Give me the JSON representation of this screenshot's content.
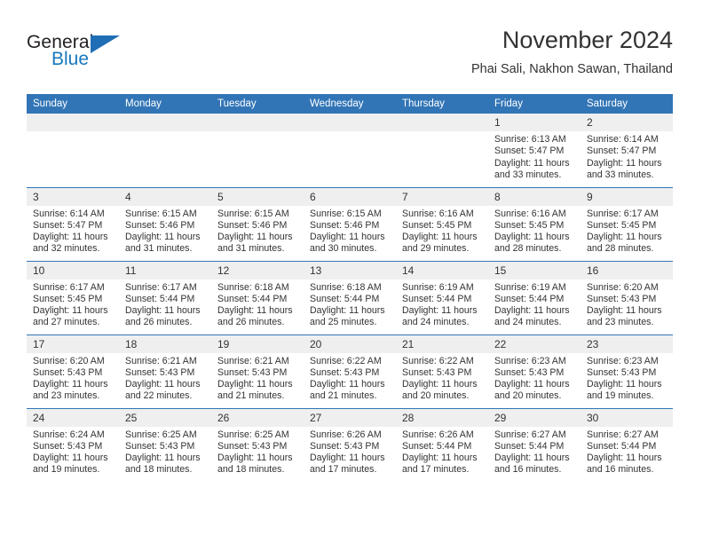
{
  "brand": {
    "name_part1": "General",
    "name_part2": "Blue",
    "logo_icon": "triangle-logo-icon"
  },
  "header": {
    "month_title": "November 2024",
    "location": "Phai Sali, Nakhon Sawan, Thailand"
  },
  "colors": {
    "header_blue": "#3275b6",
    "brand_blue": "#1878be",
    "daynum_background": "#efefef",
    "text": "#333333"
  },
  "weekday_headers": [
    "Sunday",
    "Monday",
    "Tuesday",
    "Wednesday",
    "Thursday",
    "Friday",
    "Saturday"
  ],
  "weeks": [
    {
      "days": [
        {
          "date": "",
          "empty": true,
          "sunrise": "",
          "sunset": "",
          "daylight": ""
        },
        {
          "date": "",
          "empty": true,
          "sunrise": "",
          "sunset": "",
          "daylight": ""
        },
        {
          "date": "",
          "empty": true,
          "sunrise": "",
          "sunset": "",
          "daylight": ""
        },
        {
          "date": "",
          "empty": true,
          "sunrise": "",
          "sunset": "",
          "daylight": ""
        },
        {
          "date": "",
          "empty": true,
          "sunrise": "",
          "sunset": "",
          "daylight": ""
        },
        {
          "date": "1",
          "empty": false,
          "sunrise": "Sunrise: 6:13 AM",
          "sunset": "Sunset: 5:47 PM",
          "daylight": "Daylight: 11 hours and 33 minutes."
        },
        {
          "date": "2",
          "empty": false,
          "sunrise": "Sunrise: 6:14 AM",
          "sunset": "Sunset: 5:47 PM",
          "daylight": "Daylight: 11 hours and 33 minutes."
        }
      ]
    },
    {
      "days": [
        {
          "date": "3",
          "empty": false,
          "sunrise": "Sunrise: 6:14 AM",
          "sunset": "Sunset: 5:47 PM",
          "daylight": "Daylight: 11 hours and 32 minutes."
        },
        {
          "date": "4",
          "empty": false,
          "sunrise": "Sunrise: 6:15 AM",
          "sunset": "Sunset: 5:46 PM",
          "daylight": "Daylight: 11 hours and 31 minutes."
        },
        {
          "date": "5",
          "empty": false,
          "sunrise": "Sunrise: 6:15 AM",
          "sunset": "Sunset: 5:46 PM",
          "daylight": "Daylight: 11 hours and 31 minutes."
        },
        {
          "date": "6",
          "empty": false,
          "sunrise": "Sunrise: 6:15 AM",
          "sunset": "Sunset: 5:46 PM",
          "daylight": "Daylight: 11 hours and 30 minutes."
        },
        {
          "date": "7",
          "empty": false,
          "sunrise": "Sunrise: 6:16 AM",
          "sunset": "Sunset: 5:45 PM",
          "daylight": "Daylight: 11 hours and 29 minutes."
        },
        {
          "date": "8",
          "empty": false,
          "sunrise": "Sunrise: 6:16 AM",
          "sunset": "Sunset: 5:45 PM",
          "daylight": "Daylight: 11 hours and 28 minutes."
        },
        {
          "date": "9",
          "empty": false,
          "sunrise": "Sunrise: 6:17 AM",
          "sunset": "Sunset: 5:45 PM",
          "daylight": "Daylight: 11 hours and 28 minutes."
        }
      ]
    },
    {
      "days": [
        {
          "date": "10",
          "empty": false,
          "sunrise": "Sunrise: 6:17 AM",
          "sunset": "Sunset: 5:45 PM",
          "daylight": "Daylight: 11 hours and 27 minutes."
        },
        {
          "date": "11",
          "empty": false,
          "sunrise": "Sunrise: 6:17 AM",
          "sunset": "Sunset: 5:44 PM",
          "daylight": "Daylight: 11 hours and 26 minutes."
        },
        {
          "date": "12",
          "empty": false,
          "sunrise": "Sunrise: 6:18 AM",
          "sunset": "Sunset: 5:44 PM",
          "daylight": "Daylight: 11 hours and 26 minutes."
        },
        {
          "date": "13",
          "empty": false,
          "sunrise": "Sunrise: 6:18 AM",
          "sunset": "Sunset: 5:44 PM",
          "daylight": "Daylight: 11 hours and 25 minutes."
        },
        {
          "date": "14",
          "empty": false,
          "sunrise": "Sunrise: 6:19 AM",
          "sunset": "Sunset: 5:44 PM",
          "daylight": "Daylight: 11 hours and 24 minutes."
        },
        {
          "date": "15",
          "empty": false,
          "sunrise": "Sunrise: 6:19 AM",
          "sunset": "Sunset: 5:44 PM",
          "daylight": "Daylight: 11 hours and 24 minutes."
        },
        {
          "date": "16",
          "empty": false,
          "sunrise": "Sunrise: 6:20 AM",
          "sunset": "Sunset: 5:43 PM",
          "daylight": "Daylight: 11 hours and 23 minutes."
        }
      ]
    },
    {
      "days": [
        {
          "date": "17",
          "empty": false,
          "sunrise": "Sunrise: 6:20 AM",
          "sunset": "Sunset: 5:43 PM",
          "daylight": "Daylight: 11 hours and 23 minutes."
        },
        {
          "date": "18",
          "empty": false,
          "sunrise": "Sunrise: 6:21 AM",
          "sunset": "Sunset: 5:43 PM",
          "daylight": "Daylight: 11 hours and 22 minutes."
        },
        {
          "date": "19",
          "empty": false,
          "sunrise": "Sunrise: 6:21 AM",
          "sunset": "Sunset: 5:43 PM",
          "daylight": "Daylight: 11 hours and 21 minutes."
        },
        {
          "date": "20",
          "empty": false,
          "sunrise": "Sunrise: 6:22 AM",
          "sunset": "Sunset: 5:43 PM",
          "daylight": "Daylight: 11 hours and 21 minutes."
        },
        {
          "date": "21",
          "empty": false,
          "sunrise": "Sunrise: 6:22 AM",
          "sunset": "Sunset: 5:43 PM",
          "daylight": "Daylight: 11 hours and 20 minutes."
        },
        {
          "date": "22",
          "empty": false,
          "sunrise": "Sunrise: 6:23 AM",
          "sunset": "Sunset: 5:43 PM",
          "daylight": "Daylight: 11 hours and 20 minutes."
        },
        {
          "date": "23",
          "empty": false,
          "sunrise": "Sunrise: 6:23 AM",
          "sunset": "Sunset: 5:43 PM",
          "daylight": "Daylight: 11 hours and 19 minutes."
        }
      ]
    },
    {
      "days": [
        {
          "date": "24",
          "empty": false,
          "sunrise": "Sunrise: 6:24 AM",
          "sunset": "Sunset: 5:43 PM",
          "daylight": "Daylight: 11 hours and 19 minutes."
        },
        {
          "date": "25",
          "empty": false,
          "sunrise": "Sunrise: 6:25 AM",
          "sunset": "Sunset: 5:43 PM",
          "daylight": "Daylight: 11 hours and 18 minutes."
        },
        {
          "date": "26",
          "empty": false,
          "sunrise": "Sunrise: 6:25 AM",
          "sunset": "Sunset: 5:43 PM",
          "daylight": "Daylight: 11 hours and 18 minutes."
        },
        {
          "date": "27",
          "empty": false,
          "sunrise": "Sunrise: 6:26 AM",
          "sunset": "Sunset: 5:43 PM",
          "daylight": "Daylight: 11 hours and 17 minutes."
        },
        {
          "date": "28",
          "empty": false,
          "sunrise": "Sunrise: 6:26 AM",
          "sunset": "Sunset: 5:44 PM",
          "daylight": "Daylight: 11 hours and 17 minutes."
        },
        {
          "date": "29",
          "empty": false,
          "sunrise": "Sunrise: 6:27 AM",
          "sunset": "Sunset: 5:44 PM",
          "daylight": "Daylight: 11 hours and 16 minutes."
        },
        {
          "date": "30",
          "empty": false,
          "sunrise": "Sunrise: 6:27 AM",
          "sunset": "Sunset: 5:44 PM",
          "daylight": "Daylight: 11 hours and 16 minutes."
        }
      ]
    }
  ]
}
